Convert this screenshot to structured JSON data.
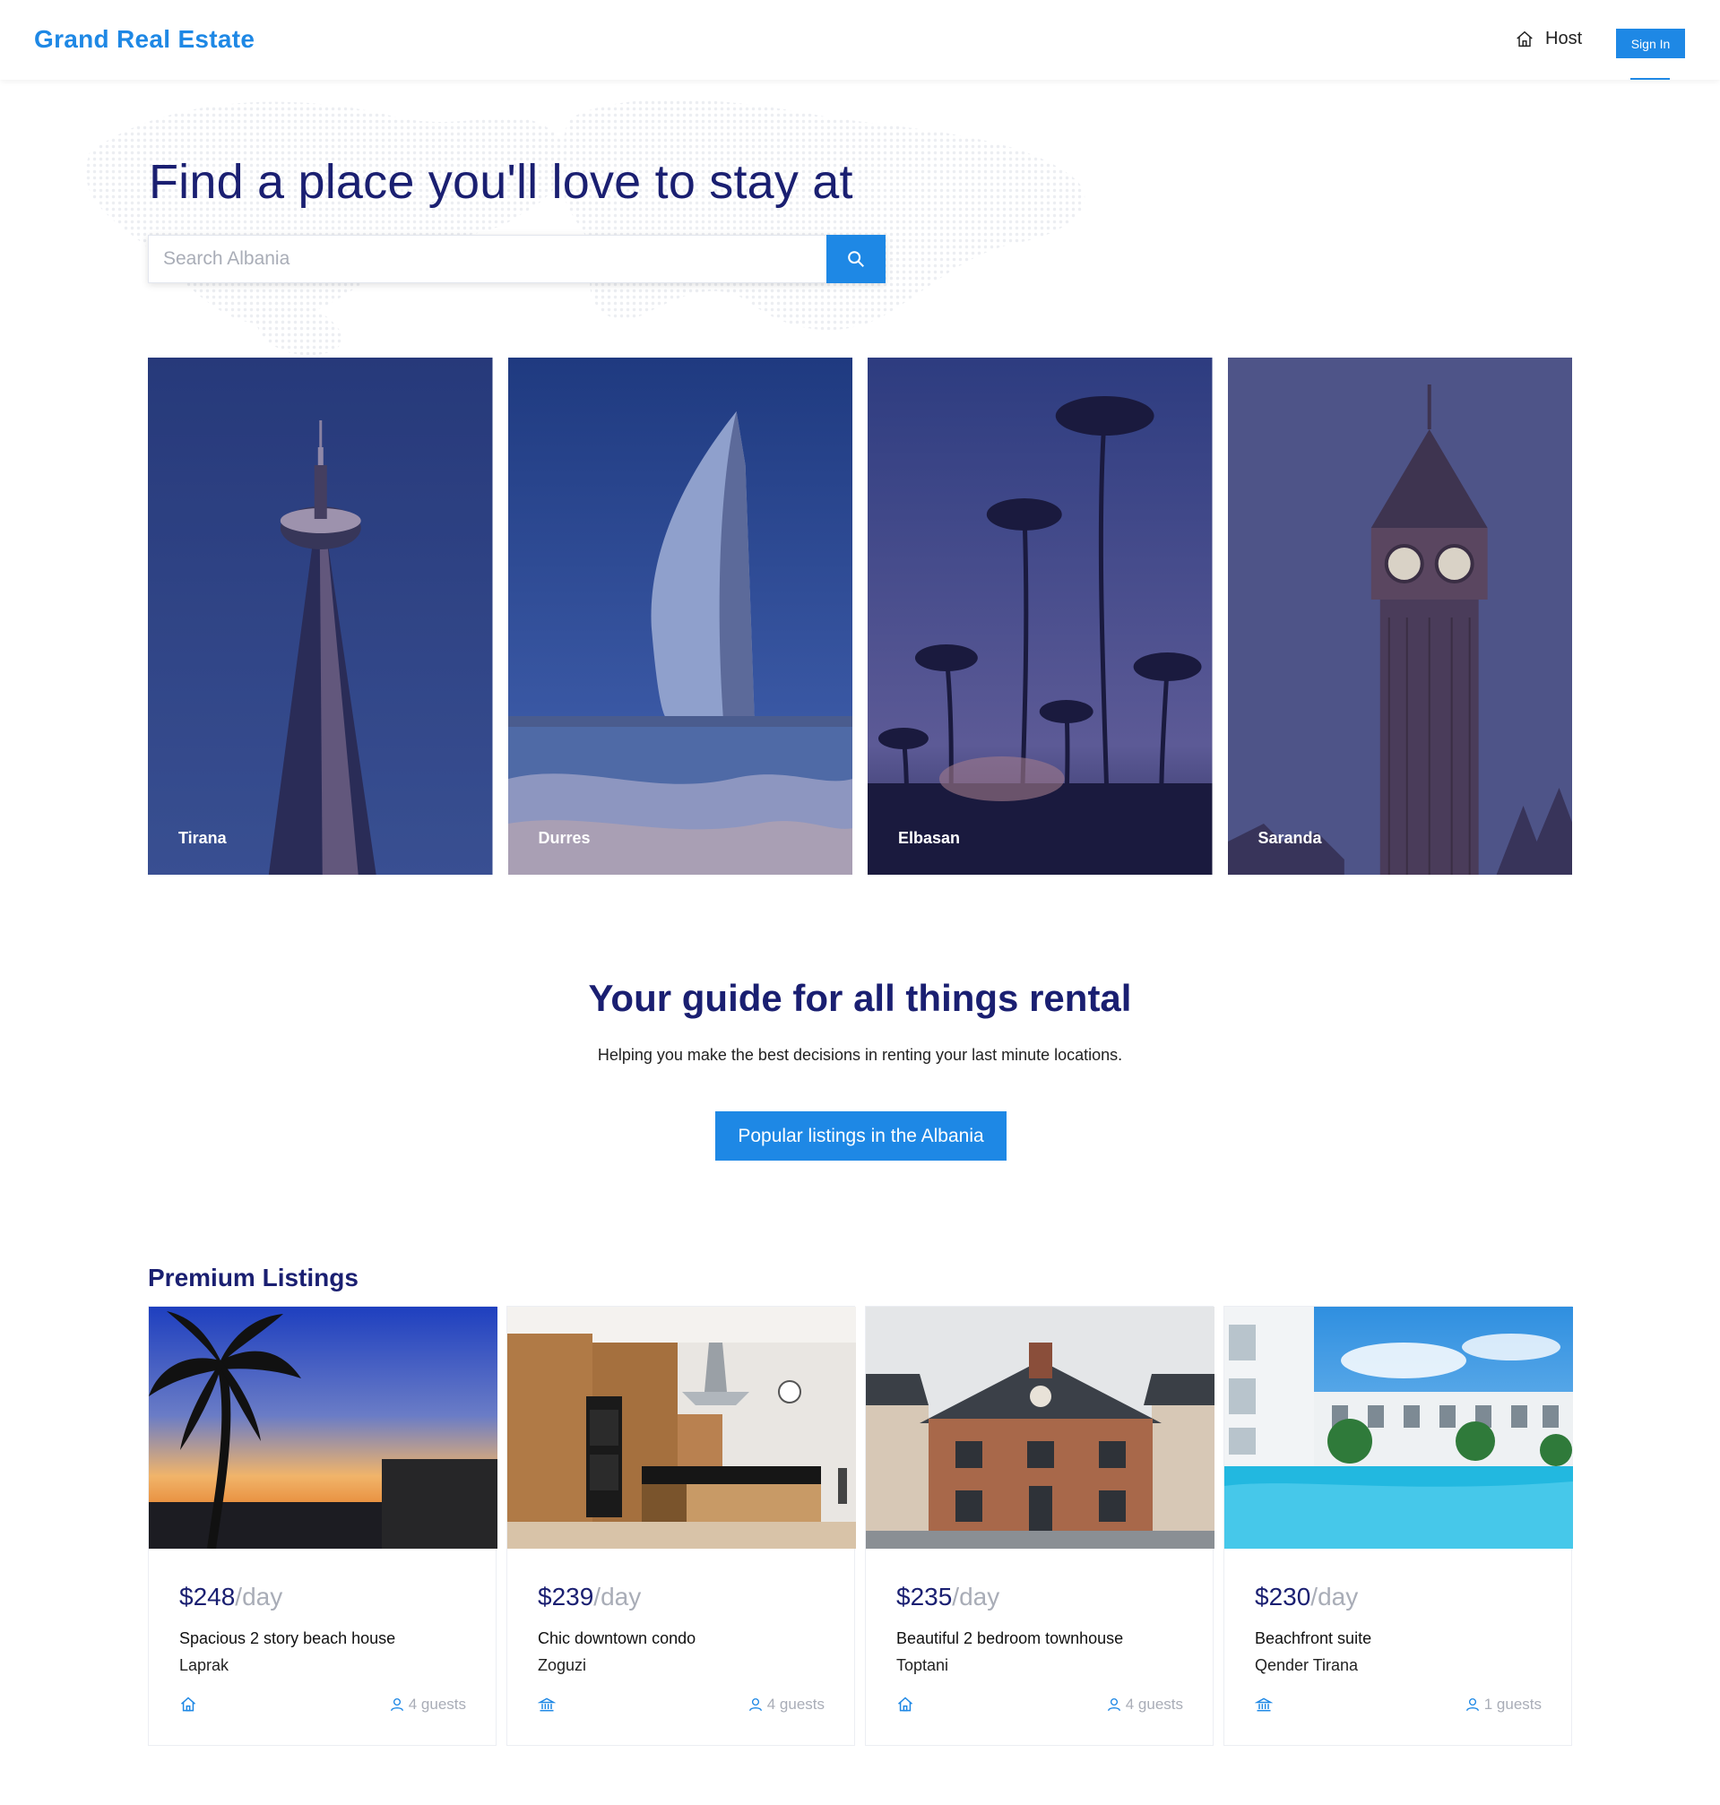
{
  "header": {
    "brand": "Grand Real Estate",
    "host_label": "Host",
    "signin_label": "Sign In"
  },
  "hero": {
    "title": "Find a place you'll love to stay at",
    "search_placeholder": "Search Albania"
  },
  "cities": [
    {
      "name": "Tirana"
    },
    {
      "name": "Durres"
    },
    {
      "name": "Elbasan"
    },
    {
      "name": "Saranda"
    }
  ],
  "guide": {
    "title": "Your guide for all things rental",
    "subtitle": "Helping you make the best decisions in renting your last minute locations.",
    "button_label": "Popular listings in the Albania"
  },
  "premium": {
    "title": "Premium Listings",
    "listings": [
      {
        "price": "$248",
        "unit": "/day",
        "title": "Spacious 2 story beach house",
        "location": "Laprak",
        "type_icon": "home-icon",
        "guests": "4 guests"
      },
      {
        "price": "$239",
        "unit": "/day",
        "title": "Chic downtown condo",
        "location": "Zoguzi",
        "type_icon": "building-icon",
        "guests": "4 guests"
      },
      {
        "price": "$235",
        "unit": "/day",
        "title": "Beautiful 2 bedroom townhouse",
        "location": "Toptani",
        "type_icon": "home-icon",
        "guests": "4 guests"
      },
      {
        "price": "$230",
        "unit": "/day",
        "title": "Beachfront suite",
        "location": "Qender Tirana",
        "type_icon": "building-icon",
        "guests": "1 guests"
      }
    ]
  },
  "colors": {
    "accent": "#1e88e5",
    "navy": "#1a1f71",
    "muted": "#a9adb7"
  }
}
